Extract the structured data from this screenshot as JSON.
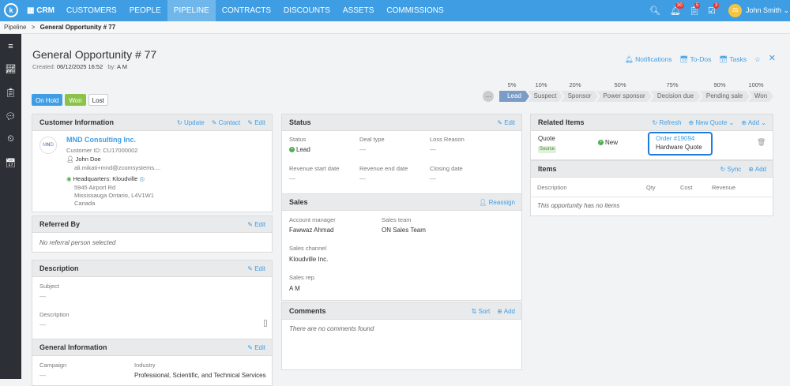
{
  "app": {
    "brand": "CRM",
    "nav": [
      "CUSTOMERS",
      "PEOPLE",
      "PIPELINE",
      "CONTRACTS",
      "DISCOUNTS",
      "ASSETS",
      "COMMISSIONS"
    ],
    "active_nav": "PIPELINE",
    "badges": {
      "bell": "30",
      "tasks": "5",
      "todo": "3"
    },
    "user_initials": "JS",
    "user_name": "John Smith ⌄",
    "accent": "#3f9ee3"
  },
  "breadcrumb": {
    "root": "Pipeline",
    "sep": ">",
    "current": "General Opportunity # 77"
  },
  "page": {
    "title": "General Opportunity # 77",
    "created_label": "Created:",
    "created_date": "06/12/2025 16:52",
    "by_label": "by:",
    "by_value": "A M",
    "links": {
      "notifications": "Notifications",
      "todos": "To-Dos",
      "tasks": "Tasks"
    }
  },
  "status_buttons": {
    "on_hold": "On Hold",
    "won": "Won",
    "lost": "Lost"
  },
  "pipeline": {
    "stages": [
      {
        "label": "Lead",
        "pct": "5%"
      },
      {
        "label": "Suspect",
        "pct": "10%"
      },
      {
        "label": "Sponsor",
        "pct": "20%"
      },
      {
        "label": "Power sponsor",
        "pct": "50%"
      },
      {
        "label": "Decision due",
        "pct": "75%"
      },
      {
        "label": "Pending sale",
        "pct": "90%"
      },
      {
        "label": "Won",
        "pct": "100%"
      }
    ],
    "active_stage": "Lead"
  },
  "customer_info": {
    "header": "Customer Information",
    "actions": {
      "update": "Update",
      "contact": "Contact",
      "edit": "Edit"
    },
    "company": "MND Consulting Inc.",
    "customer_id": "Customer ID: CU17000002",
    "contact_name": "John Doe",
    "contact_email": "ali.mikati+mnd@zcomsystems....",
    "hq": "Headquarters: Kloudville",
    "addr1": "5945 Airport Rd",
    "addr2": "Mississauga Ontario, L4V1W1",
    "addr3": "Canada"
  },
  "referred_by": {
    "header": "Referred By",
    "edit": "Edit",
    "empty": "No referral person selected"
  },
  "description": {
    "header": "Description",
    "edit": "Edit",
    "subject_label": "Subject",
    "subject_value": "—",
    "description_label": "Description",
    "description_value": "—"
  },
  "general_info": {
    "header": "General Information",
    "edit": "Edit",
    "campaign_label": "Campaign",
    "campaign_value": "—",
    "industry_label": "Industry",
    "industry_value": "Professional, Scientific, and Technical Services"
  },
  "status_panel": {
    "header": "Status",
    "edit": "Edit",
    "status_label": "Status",
    "status_value": "Lead",
    "deal_type_label": "Deal type",
    "deal_type_value": "—",
    "loss_reason_label": "Loss Reason",
    "loss_reason_value": "—",
    "rev_start_label": "Revenue start date",
    "rev_start_value": "—",
    "rev_end_label": "Revenue end date",
    "rev_end_value": "—",
    "closing_label": "Closing date",
    "closing_value": "—"
  },
  "sales": {
    "header": "Sales",
    "reassign": "Reassign",
    "account_manager_label": "Account manager",
    "account_manager_value": "Fawwaz Ahmad",
    "sales_team_label": "Sales team",
    "sales_team_value": "ON Sales Team",
    "channel_label": "Sales channel",
    "channel_value": "Kloudville Inc.",
    "rep_label": "Sales rep.",
    "rep_value": "A M"
  },
  "comments": {
    "header": "Comments",
    "sort": "Sort",
    "add": "Add",
    "empty": "There are no comments found"
  },
  "related": {
    "header": "Related Items",
    "refresh": "Refresh",
    "new_quote": "New Quote ⌄",
    "add": "Add ⌄",
    "item_type": "Quote",
    "item_badge": "Source",
    "item_status": "New",
    "order_link": "Order #19094",
    "order_name": "Hardware Quote"
  },
  "items": {
    "header": "Items",
    "sync": "Sync",
    "add": "Add",
    "columns": [
      "Description",
      "Qty",
      "Cost",
      "Revenue"
    ],
    "empty": "This opportunity has no items"
  }
}
